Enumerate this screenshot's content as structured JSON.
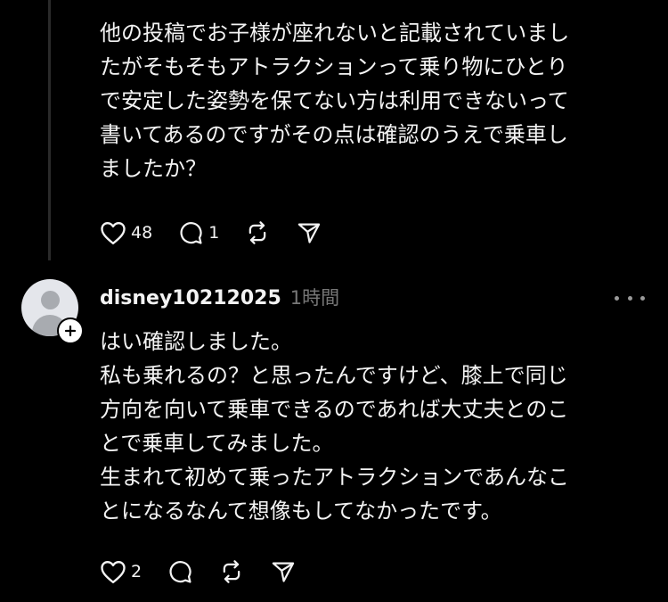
{
  "post": {
    "lines": [
      "他の投稿でお子様が座れないと記載されていまし",
      "たがそもそもアトラクションって乗り物にひとり",
      "で安定した姿勢を保てない方は利用できないって",
      "書いてあるのですがその点は確認のうえで乗車し",
      "ましたか？"
    ],
    "likes": "48",
    "comments": "1"
  },
  "reply": {
    "username": "disney10212025",
    "time": "1時間",
    "lines": [
      "はい確認しました。",
      "私も乗れるの？と思ったんですけど、膝上で同じ",
      "方向を向いて乗車できるのであれば大丈夫とのこ",
      "とで乗車してみました。",
      "生まれて初めて乗ったアトラクションであんなこ",
      "とになるなんて想像もしてなかったです。"
    ],
    "likes": "2"
  },
  "icons": {
    "like": "heart-icon",
    "comment": "comment-bubble-icon",
    "repost": "repost-icon",
    "share": "send-icon",
    "more": "more-dots-icon",
    "follow": "plus-icon"
  }
}
